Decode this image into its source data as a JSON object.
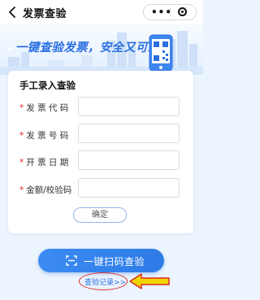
{
  "header": {
    "title": "发票查验",
    "more_glyph": "•••"
  },
  "banner": {
    "slogan": "一键查验发票，安全又可靠"
  },
  "form": {
    "title": "手工录入查验",
    "required_mark": "*",
    "fields": [
      {
        "label": "发 票 代 码",
        "value": "",
        "placeholder": ""
      },
      {
        "label": "发 票 号 码",
        "value": "",
        "placeholder": ""
      },
      {
        "label": "开 票 日 期",
        "value": "",
        "placeholder": ""
      },
      {
        "label": "金额/校验码",
        "value": "",
        "placeholder": ""
      }
    ],
    "confirm_label": "确定"
  },
  "scan": {
    "label": "一键扫码查验"
  },
  "records": {
    "label": "查验记录>>"
  },
  "colors": {
    "accent": "#2e7be8",
    "required": "#e02020",
    "highlight_ellipse": "#d92a2a",
    "arrow_fill": "#f3d400"
  }
}
